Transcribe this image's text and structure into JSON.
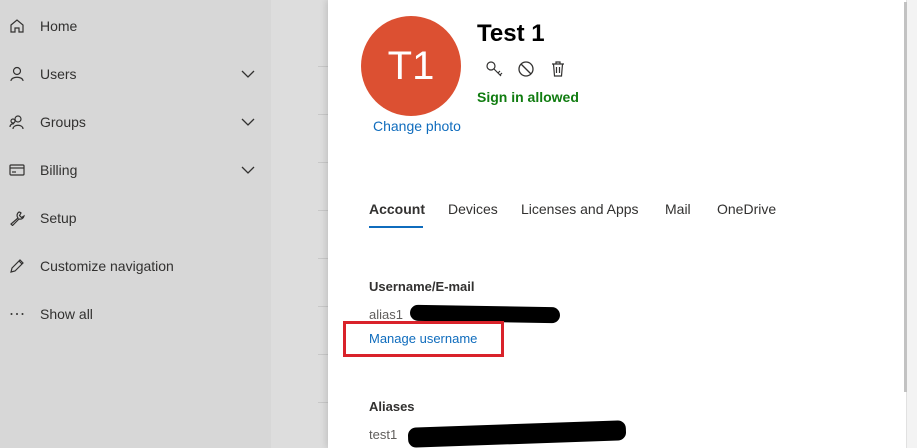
{
  "nav": {
    "items": [
      {
        "label": "Home",
        "icon": "home-icon",
        "chevron": false
      },
      {
        "label": "Users",
        "icon": "user-icon",
        "chevron": true
      },
      {
        "label": "Groups",
        "icon": "groups-icon",
        "chevron": true
      },
      {
        "label": "Billing",
        "icon": "billing-icon",
        "chevron": true
      },
      {
        "label": "Setup",
        "icon": "wrench-icon",
        "chevron": false
      },
      {
        "label": "Customize navigation",
        "icon": "pencil-icon",
        "chevron": false
      },
      {
        "label": "Show all",
        "icon": "ellipsis-icon",
        "chevron": false
      }
    ]
  },
  "user": {
    "initials": "T1",
    "name": "Test 1",
    "change_photo": "Change photo",
    "sign_in_status": "Sign in allowed",
    "avatar_color": "#dc5032"
  },
  "tabs": [
    "Account",
    "Devices",
    "Licenses and Apps",
    "Mail",
    "OneDrive"
  ],
  "active_tab": "Account",
  "account": {
    "username_heading": "Username/E-mail",
    "username_value": "alias1",
    "manage_username": "Manage username",
    "aliases_heading": "Aliases",
    "aliases_value": "test1"
  },
  "colors": {
    "link": "#0f6cbd",
    "status_green": "#107c10",
    "highlight_red": "#d9222a"
  }
}
